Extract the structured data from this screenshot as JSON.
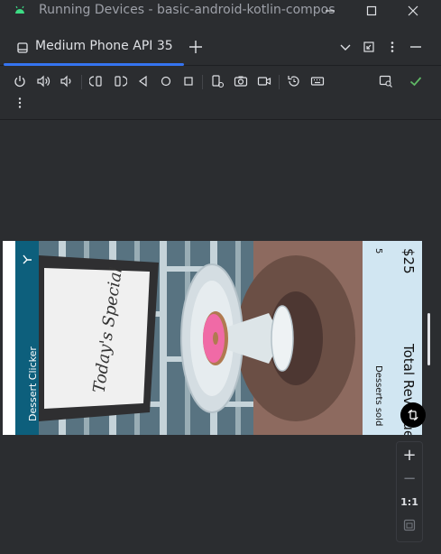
{
  "window": {
    "title": "Running Devices - basic-android-kotlin-compos",
    "controls": [
      "minimize-icon",
      "maximize-icon",
      "close-icon"
    ]
  },
  "tabs": [
    {
      "label": "Medium Phone API 35",
      "icon": "phone-icon",
      "active": true
    }
  ],
  "tab_actions": [
    "add-tab-icon",
    "chevron-down-icon",
    "restore-icon",
    "more-vertical-icon",
    "minimize-panel-icon"
  ],
  "toolbar": {
    "items": [
      "power-icon",
      "volume-up-icon",
      "volume-down-icon",
      "rotate-left-icon",
      "rotate-right-icon",
      "fold-icon",
      "back-icon",
      "home-icon",
      "overview-icon",
      "device-settings-icon",
      "screenshot-icon",
      "screen-record-icon",
      "reset-icon",
      "keyboard-icon",
      "device-explorer-icon",
      "check-icon",
      "more-vertical-icon"
    ],
    "accent": "#5fb865"
  },
  "app": {
    "title": "Dessert Clicker",
    "board_text": "Today's Special",
    "desserts_sold_label": "Desserts sold",
    "desserts_sold_value": "5",
    "revenue_label": "Total Revenue",
    "revenue_value": "$25",
    "appbar_color": "#0d5f7c",
    "panel_color": "#d1e6f2"
  },
  "zoom": {
    "zoom_in": "+",
    "zoom_out": "−",
    "actual_size": "1:1",
    "fit": "fit-screen-icon"
  }
}
